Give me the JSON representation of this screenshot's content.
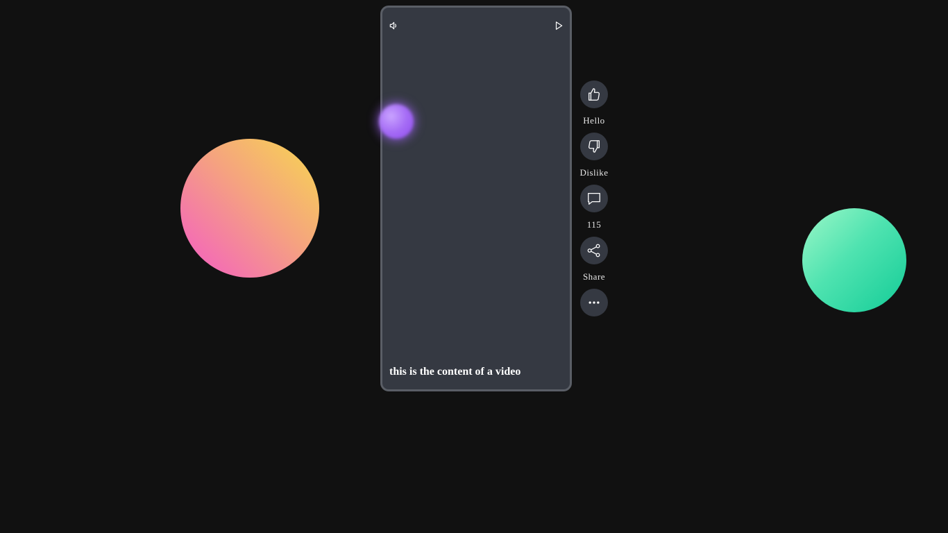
{
  "video": {
    "caption": "this is the content of a video"
  },
  "controls": {
    "sound_icon": "volume-icon",
    "play_icon": "play-icon"
  },
  "actions": [
    {
      "icon": "thumbs-up-icon",
      "label": "Hello"
    },
    {
      "icon": "thumbs-down-icon",
      "label": "Dislike"
    },
    {
      "icon": "comment-icon",
      "label": "115"
    },
    {
      "icon": "share-icon",
      "label": "Share"
    },
    {
      "icon": "more-icon",
      "label": ""
    }
  ],
  "colors": {
    "background": "#111111",
    "card": "#353942",
    "card_border": "#5a5e66",
    "text": "#ffffff"
  }
}
